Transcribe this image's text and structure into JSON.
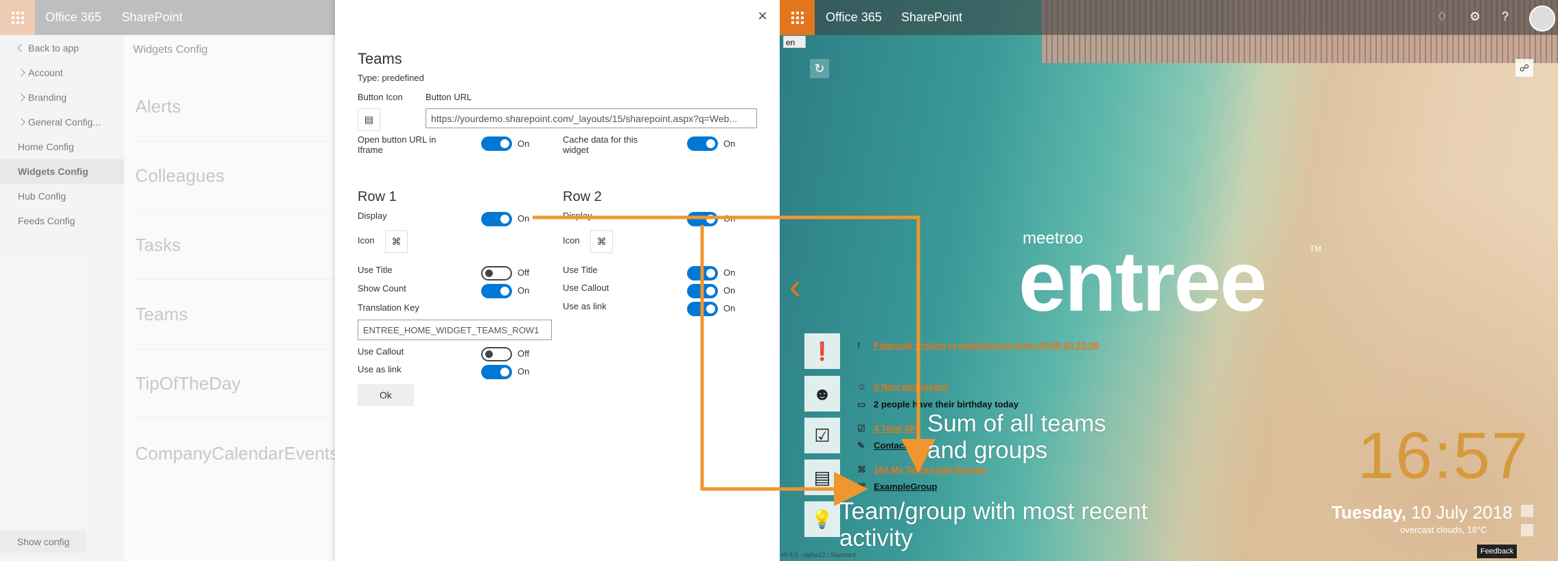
{
  "left": {
    "suitebar": {
      "app": "Office 365",
      "site": "SharePoint"
    },
    "nav": [
      {
        "label": "Back to app",
        "chev": "left",
        "selected": false
      },
      {
        "label": "Account",
        "chev": "right",
        "selected": false
      },
      {
        "label": "Branding",
        "chev": "right",
        "selected": false
      },
      {
        "label": "General Config...",
        "chev": "right",
        "selected": false
      },
      {
        "label": "Home Config",
        "chev": "",
        "selected": false
      },
      {
        "label": "Widgets Config",
        "chev": "",
        "selected": true
      },
      {
        "label": "Hub Config",
        "chev": "",
        "selected": false
      },
      {
        "label": "Feeds Config",
        "chev": "",
        "selected": false
      }
    ],
    "heading": "Widgets Config",
    "widgets": [
      "Alerts",
      "Colleagues",
      "Tasks",
      "Teams",
      "TipOfTheDay",
      "CompanyCalendarEvents"
    ],
    "show_config": "Show config"
  },
  "panel": {
    "close": "×",
    "title": "Teams",
    "type": "Type: predefined",
    "button_icon_label": "Button Icon",
    "button_url_label": "Button URL",
    "button_icon": "newspaper-icon",
    "button_url": "https://yourdemo.sharepoint.com/_layouts/15/sharepoint.aspx?q=Web...",
    "open_iframe_label": "Open button URL in Iframe",
    "open_iframe_state": "On",
    "cache_label": "Cache data for this widget",
    "cache_state": "On",
    "row1": {
      "title": "Row 1",
      "display_label": "Display",
      "display_state": "On",
      "icon_label": "Icon",
      "icon": "network-icon",
      "use_title_label": "Use Title",
      "use_title_state": "Off",
      "show_count_label": "Show Count",
      "show_count_state": "On",
      "translation_key_label": "Translation Key",
      "translation_key_value": "ENTREE_HOME_WIDGET_TEAMS_ROW1",
      "use_callout_label": "Use Callout",
      "use_callout_state": "Off",
      "use_as_link_label": "Use as link",
      "use_as_link_state": "On"
    },
    "row2": {
      "title": "Row 2",
      "display_label": "Display",
      "display_state": "On",
      "icon_label": "Icon",
      "icon": "network-icon",
      "use_title_label": "Use Title",
      "use_title_state": "On",
      "use_callout_label": "Use Callout",
      "use_callout_state": "On",
      "use_as_link_label": "Use as link",
      "use_as_link_state": "On"
    },
    "ok": "Ok"
  },
  "preview": {
    "suitebar": {
      "app": "Office 365",
      "site": "SharePoint",
      "icons": [
        "bell-icon",
        "gear-icon",
        "help-icon",
        "avatar"
      ]
    },
    "language": "en",
    "brand_small": "meetroo",
    "brand_big": "entree",
    "trademark": "TM",
    "feeds": [
      {
        "icon": "!",
        "text": "Financial system in maintenance from 20:00 till 22:00",
        "style": "link"
      },
      {
        "icon": "☺",
        "text": "0 New employees",
        "style": "link"
      },
      {
        "icon": "▭",
        "text": "2 people have their birthday today",
        "style": "dark"
      },
      {
        "icon": "☑",
        "text": "4 Total SP...",
        "style": "link"
      },
      {
        "icon": "✎",
        "text": "Contact ...",
        "style": "darklink"
      },
      {
        "icon": "⌘",
        "text": "164 My Teams and Groups",
        "style": "link"
      },
      {
        "icon": "⌘",
        "text": "ExampleGroup",
        "style": "darklink"
      }
    ],
    "side_buttons": [
      "alert-icon",
      "colleagues-icon",
      "tasks-icon",
      "teams-icon",
      "tip-icon"
    ],
    "clock": "16:57",
    "date_day": "Tuesday,",
    "date_rest": " 10 July 2018",
    "weather": "overcast clouds, 18°C",
    "feedback": "Feedback",
    "version": "v0.8.0 · alpha12 / Standard"
  },
  "annotations": {
    "sum_note": "Sum of all teams and groups",
    "recent_note": "Team/group with most recent activity",
    "arrow_color": "#f0962e"
  },
  "colors": {
    "accent": "#e3761c",
    "toggle_on": "#0078d4",
    "clock": "#d69a3c"
  }
}
